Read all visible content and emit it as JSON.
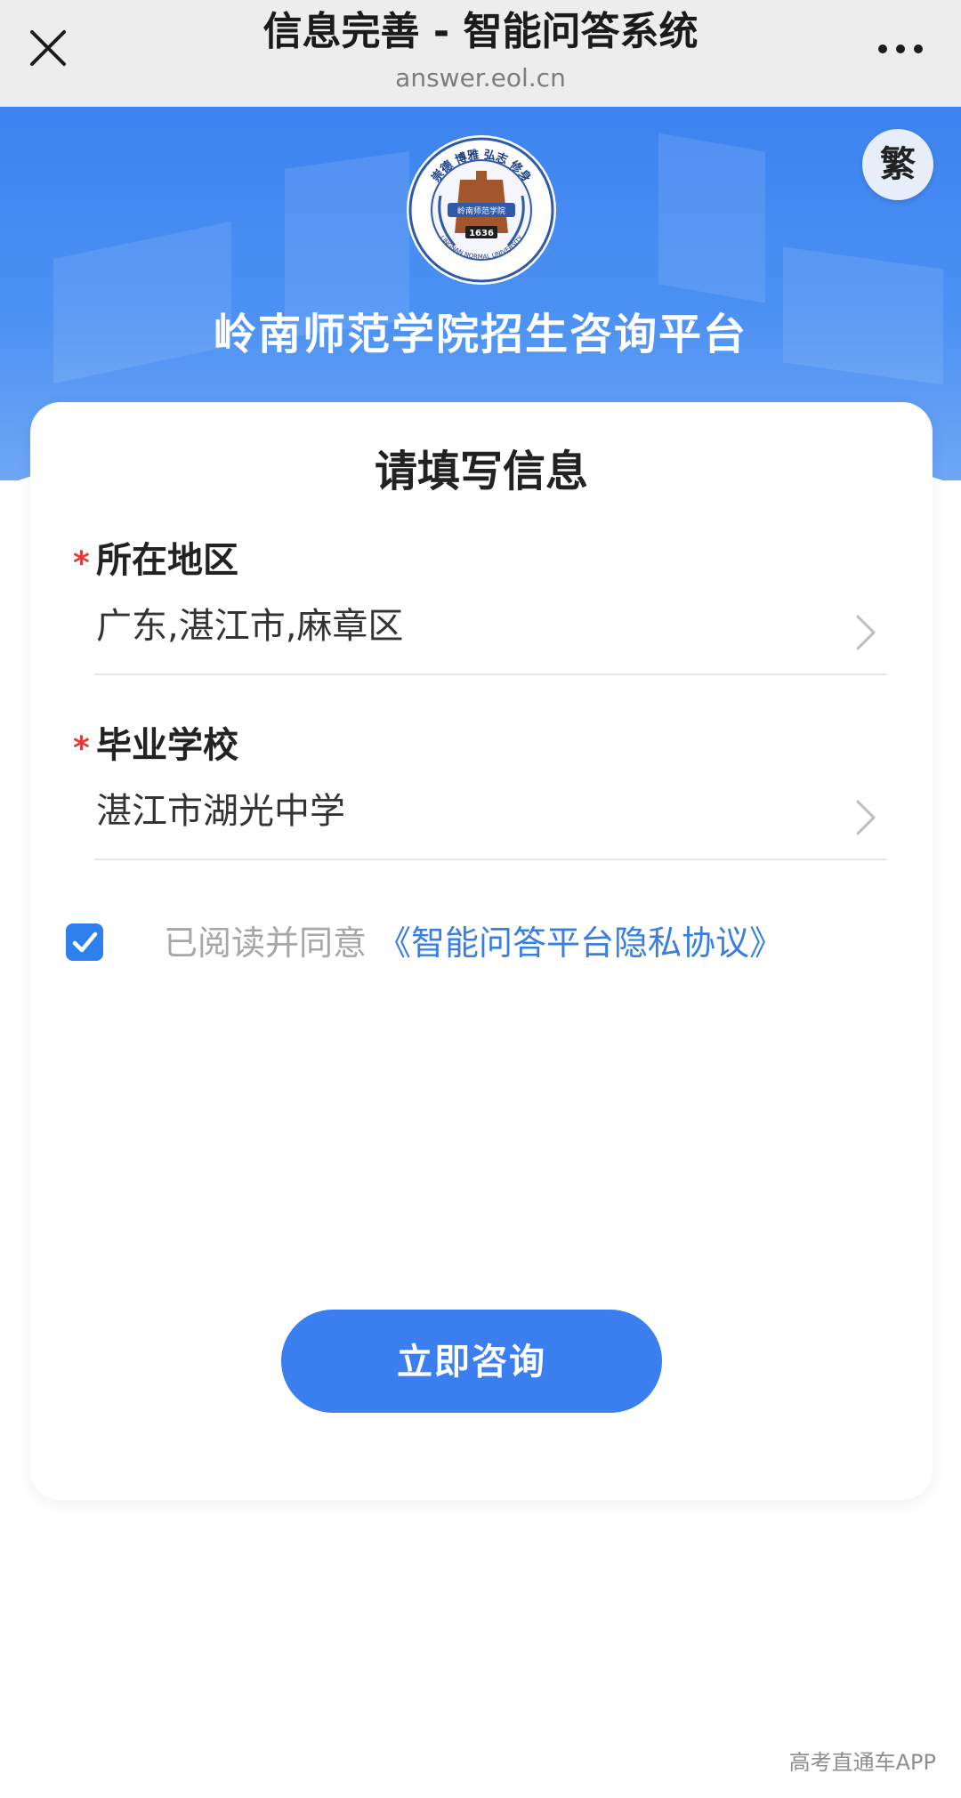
{
  "nav": {
    "title": "信息完善 - 智能问答系统",
    "url": "answer.eol.cn",
    "close_icon": "close-icon",
    "more_icon": "more-dots-icon"
  },
  "banner": {
    "lang_toggle": "繁",
    "platform_title": "岭南师范学院招生咨询平台",
    "logo": {
      "top_text": "崇德 博雅 弘志 修身",
      "badge_text": "岭南师范学院",
      "year": "1636",
      "english": "LINGNAN NORMAL UNIVERSITY"
    }
  },
  "form": {
    "title": "请填写信息",
    "region": {
      "label": "所在地区",
      "value": "广东,湛江市,麻章区",
      "required_mark": "*"
    },
    "school": {
      "label": "毕业学校",
      "value": "湛江市湖光中学",
      "required_mark": "*"
    },
    "agreement": {
      "checked": true,
      "text": "已阅读并同意",
      "link": "《智能问答平台隐私协议》"
    },
    "submit_label": "立即咨询"
  },
  "watermark": "高考直通车APP",
  "colors": {
    "primary": "#3a7ef0",
    "banner_top": "#3d83f0",
    "required": "#e53935",
    "link": "#3a7fe0"
  }
}
